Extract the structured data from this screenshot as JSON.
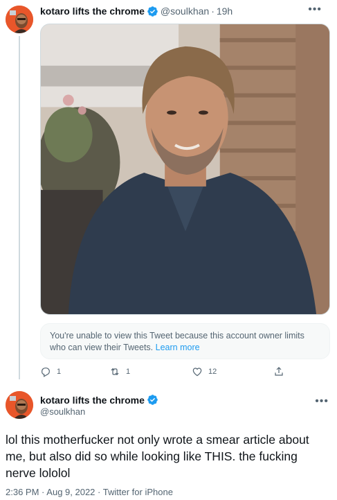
{
  "tweet1": {
    "display_name": "kotaro lifts the chrome",
    "handle": "@soulkhan",
    "time": "19h",
    "separator": "·",
    "more_icon": "more-dots-icon",
    "photo_description_icon": "photo",
    "quote_notice": "You're unable to view this Tweet because this account owner limits who can view their Tweets.",
    "learn_more": "Learn more",
    "actions": {
      "reply_count": "1",
      "retweet_count": "1",
      "like_count": "12",
      "share_count": ""
    }
  },
  "tweet2": {
    "display_name": "kotaro lifts the chrome",
    "handle": "@soulkhan",
    "text": "lol this motherfucker not only wrote a smear article about me, but also did so while looking like THIS. the fucking nerve lololol",
    "time": "2:36 PM",
    "date": "Aug 9, 2022",
    "source": "Twitter for iPhone",
    "sep": "·"
  },
  "colors": {
    "accent": "#1d9bf0",
    "secondary_text": "#536471",
    "avatar_bg": "#e8562a"
  }
}
